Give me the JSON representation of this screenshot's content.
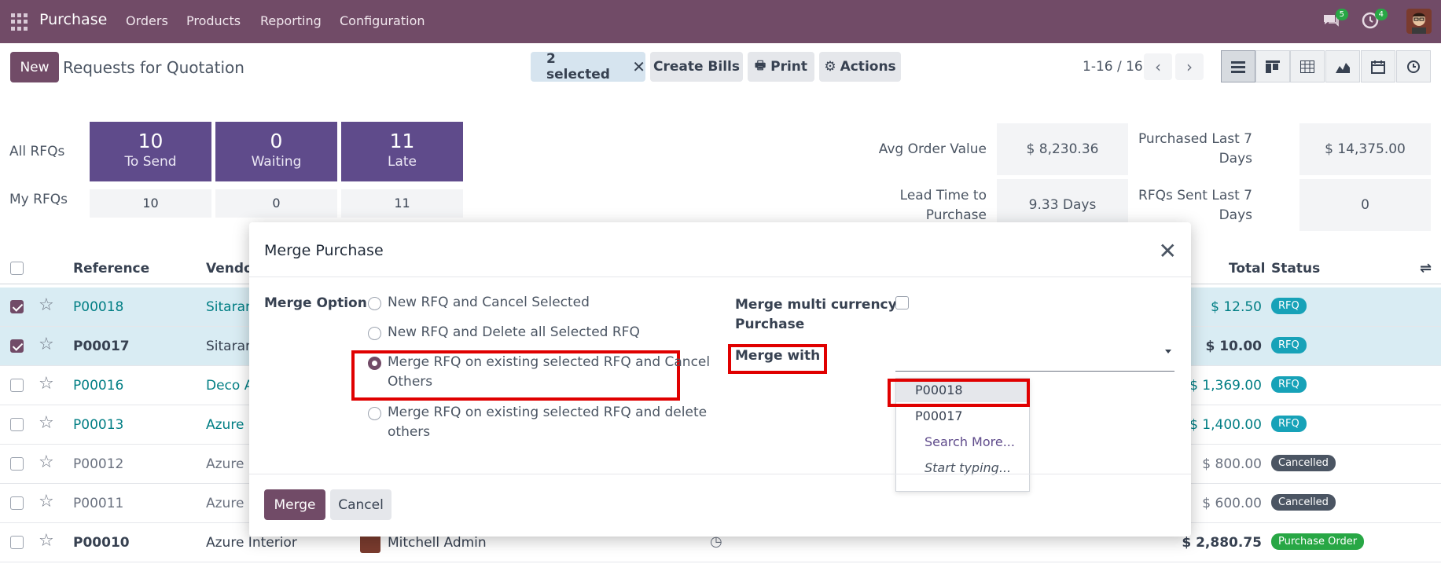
{
  "navbar": {
    "brand": "Purchase",
    "menu": [
      "Orders",
      "Products",
      "Reporting",
      "Configuration"
    ],
    "messages_badge": "5",
    "activities_badge": "4"
  },
  "control_panel": {
    "new_label": "New",
    "title": "Requests for Quotation",
    "selected_label": "2 selected",
    "create_bills_label": "Create Bills",
    "print_label": "Print",
    "actions_label": "Actions",
    "pager": "1-16 / 16"
  },
  "dashboard": {
    "row_labels": [
      "All RFQs",
      "My RFQs"
    ],
    "cards": [
      {
        "num": "10",
        "label": "To Send",
        "mine": "10"
      },
      {
        "num": "0",
        "label": "Waiting",
        "mine": "0"
      },
      {
        "num": "11",
        "label": "Late",
        "mine": "11"
      }
    ],
    "kpis": {
      "avg_order_value_label": "Avg Order Value",
      "avg_order_value": "$ 8,230.36",
      "lead_time_label_1": "Lead Time to",
      "lead_time_label_2": "Purchase",
      "lead_time": "9.33 Days",
      "purchased_label_1": "Purchased Last 7",
      "purchased_label_2": "Days",
      "purchased": "$ 14,375.00",
      "rfqs_sent_label_1": "RFQs Sent Last 7",
      "rfqs_sent_label_2": "Days",
      "rfqs_sent": "0"
    }
  },
  "list": {
    "headers": {
      "reference": "Reference",
      "vendor": "Vendor",
      "total": "Total",
      "status": "Status"
    },
    "rows": [
      {
        "ref": "P00018",
        "vendor": "Sitaram",
        "total": "$ 12.50",
        "status": "RFQ"
      },
      {
        "ref": "P00017",
        "vendor": "Sitaram",
        "total": "$ 10.00",
        "status": "RFQ"
      },
      {
        "ref": "P00016",
        "vendor": "Deco A",
        "total": "$ 1,369.00",
        "status": "RFQ"
      },
      {
        "ref": "P00013",
        "vendor": "Azure I",
        "total": "$ 1,400.00",
        "status": "RFQ"
      },
      {
        "ref": "P00012",
        "vendor": "Azure I",
        "total": "$ 800.00",
        "status": "Cancelled"
      },
      {
        "ref": "P00011",
        "vendor": "Azure I",
        "total": "$ 600.00",
        "status": "Cancelled"
      },
      {
        "ref": "P00010",
        "vendor": "Azure Interior",
        "buyer": "Mitchell Admin",
        "total": "$ 2,880.75",
        "status": "Purchase Order"
      }
    ],
    "colors": {
      "rfq": "#17a2b8",
      "cancelled": "#4b5563",
      "purchase_order": "#28a745"
    }
  },
  "dialog": {
    "title": "Merge Purchase",
    "merge_option_label": "Merge Option",
    "options": [
      "New RFQ and Cancel Selected",
      "New RFQ and Delete all Selected RFQ",
      "Merge RFQ on existing selected RFQ and Cancel",
      "Others",
      "Merge RFQ on existing selected RFQ and delete",
      "others"
    ],
    "selected_option_index": 2,
    "multi_currency_label_1": "Merge multi currency",
    "multi_currency_label_2": "Purchase",
    "merge_with_label": "Merge with",
    "merge_with_value": "",
    "dropdown": [
      "P00018",
      "P00017",
      "Search More...",
      "Start typing..."
    ],
    "merge_button": "Merge",
    "cancel_button": "Cancel"
  }
}
